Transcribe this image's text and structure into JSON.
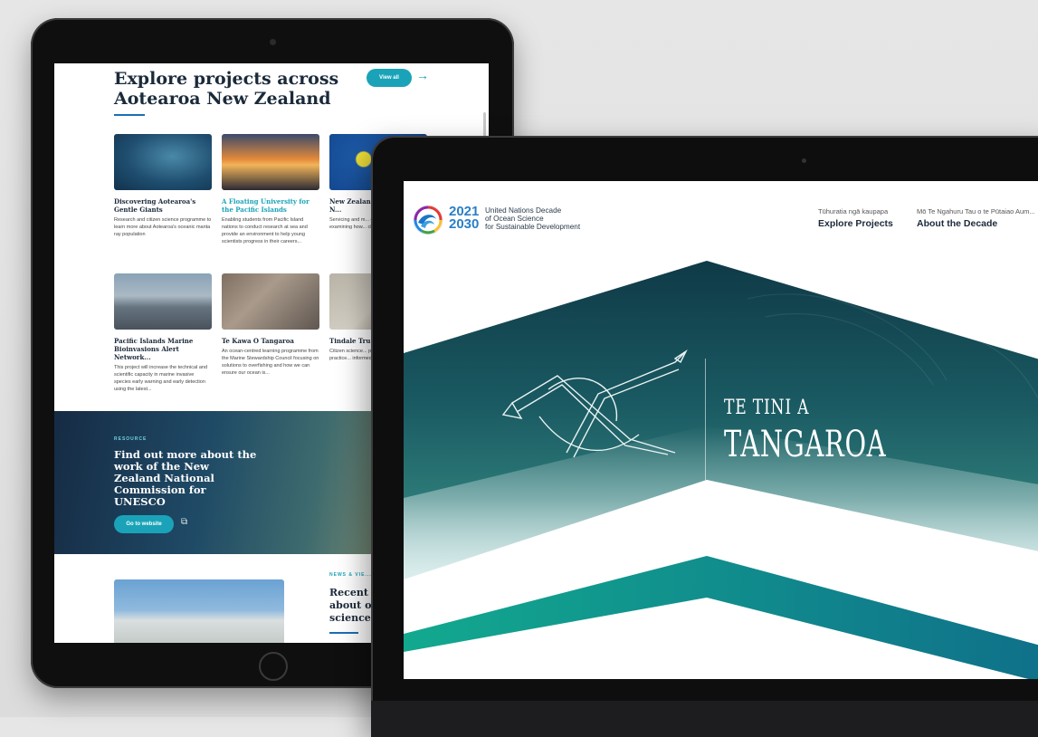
{
  "tablet": {
    "section_title": "Explore projects across Aotearoa New Zealand",
    "view_all_label": "View all",
    "arrow_glyph": "→",
    "cards": [
      {
        "title": "Discovering Aotearoa's Gentle Giants",
        "desc": "Research and citizen science programme to learn more about Aotearoa's oceanic manta ray population",
        "image": "manta-ray-photo"
      },
      {
        "title": "A Floating University for the Pacific Islands",
        "desc": "Enabling students from Pacific Island nations to conduct research at sea and provide an environment to help young scientists progress in their careers...",
        "image": "sunset-ship-photo"
      },
      {
        "title": "New Zealand ... Detection N...",
        "desc": "Servicing and m... of 12 buoys d... examining how... change over tim...",
        "image": "buoy-photo"
      },
      {
        "title": "Pacific Islands Marine Bioinvasions Alert Network...",
        "desc": "This project will increase the technical and scientific capacity in marine invasive species early warning and early detection using the latest...",
        "image": "pier-workers-photo"
      },
      {
        "title": "Te Kawa O Tangaroa",
        "desc": "An ocean-centred learning programme from the Marine Stewardship Council focusing on solutions to overfishing and how we can ensure our ocean is...",
        "image": "people-photo"
      },
      {
        "title": "Tindale Tru... Programme",
        "desc": "Citizen science... programme to... fishing practice... informed decisi...",
        "image": "fish-photo"
      }
    ],
    "banner": {
      "kicker": "RESOURCE",
      "headline": "Find out more about the work of the New Zealand National Commission for UNESCO",
      "button_label": "Go to website",
      "external_glyph": "⧉"
    },
    "news": {
      "kicker": "NEWS & VIE...",
      "headline": "Recent ...\nabout o...\nscience..."
    }
  },
  "laptop": {
    "logo": {
      "years": "2021\n2030",
      "text": "United Nations Decade\nof Ocean Science\nfor Sustainable Development"
    },
    "nav": [
      {
        "sub": "Tūhuratia ngā kaupapa",
        "main": "Explore Projects"
      },
      {
        "sub": "Mō Te Ngahuru Tau o te Pūtaiao Aum...",
        "main": "About the Decade"
      }
    ],
    "hero": {
      "line1": "TE TINI A",
      "line2": "TANGAROA"
    },
    "colors": {
      "accent_teal": "#1aa3b8",
      "accent_blue": "#1a6fb5",
      "hero_dark": "#123f4c",
      "stripe_teal": "#13a58f"
    }
  }
}
